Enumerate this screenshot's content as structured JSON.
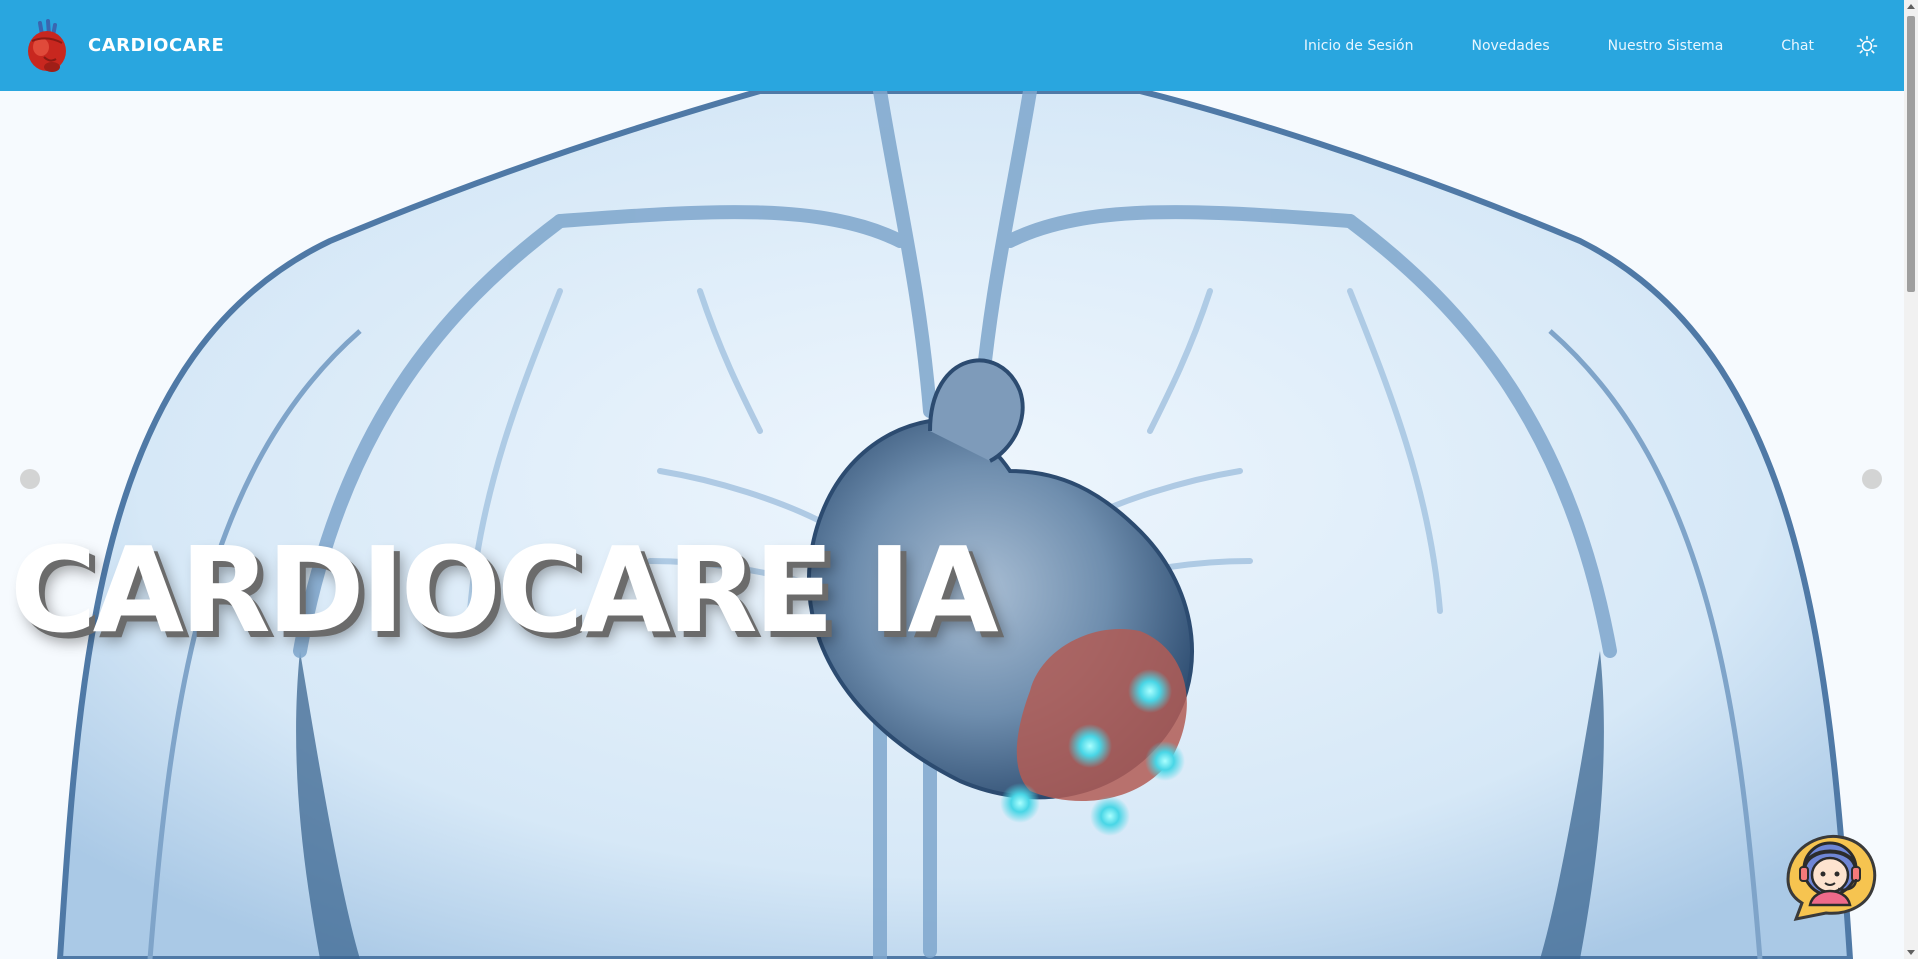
{
  "navbar": {
    "brand_name": "CARDIOCARE",
    "logo_icon": "anatomical-heart-icon",
    "links": [
      {
        "label": "Inicio de Sesión"
      },
      {
        "label": "Novedades"
      },
      {
        "label": "Nuestro Sistema"
      },
      {
        "label": "Chat"
      }
    ],
    "theme_toggle_icon": "sun-icon",
    "background_color": "#29a6df"
  },
  "hero": {
    "title": "CARDIOCARE IA",
    "image": "chest-xray-heart-illustration",
    "carousel_controls": [
      "carousel-prev-dot",
      "carousel-next-dot"
    ]
  },
  "chat_widget": {
    "icon": "support-agent-chat-icon"
  }
}
